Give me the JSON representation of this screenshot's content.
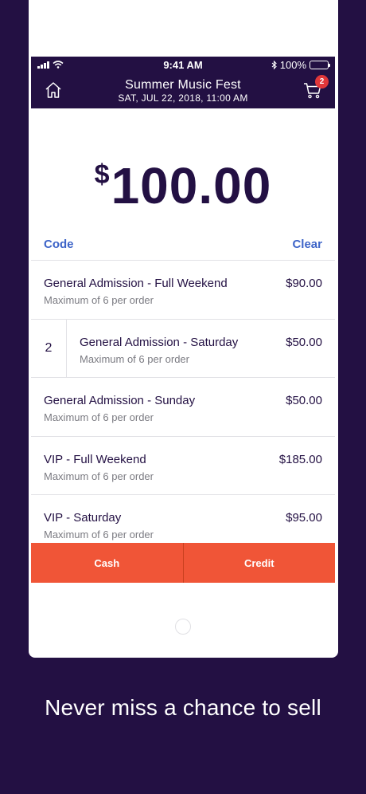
{
  "status_bar": {
    "time": "9:41 AM",
    "battery": "100%",
    "icons": [
      "signal-icon",
      "wifi-icon",
      "bluetooth-icon",
      "battery-icon"
    ]
  },
  "header": {
    "title": "Summer Music Fest",
    "subtitle": "SAT, JUL 22, 2018, 11:00 AM",
    "cart_count": "2",
    "icons": {
      "home": "home-icon",
      "cart": "cart-icon"
    }
  },
  "amount": {
    "currency": "$",
    "value": "100.00"
  },
  "actions": {
    "code": "Code",
    "clear": "Clear"
  },
  "tickets": [
    {
      "name": "General Admission - Full Weekend",
      "limit": "Maximum of 6 per order",
      "price": "$90.00",
      "quantity": ""
    },
    {
      "name": "General Admission - Saturday",
      "limit": "Maximum of 6 per order",
      "price": "$50.00",
      "quantity": "2"
    },
    {
      "name": "General Admission - Sunday",
      "limit": "Maximum of 6 per order",
      "price": "$50.00",
      "quantity": ""
    },
    {
      "name": "VIP - Full Weekend",
      "limit": "Maximum of 6 per order",
      "price": "$185.00",
      "quantity": ""
    },
    {
      "name": "VIP - Saturday",
      "limit": "Maximum of 6 per order",
      "price": "$95.00",
      "quantity": ""
    }
  ],
  "payment": {
    "cash": "Cash",
    "credit": "Credit"
  },
  "tagline": "Never miss a chance to sell",
  "colors": {
    "background": "#231043",
    "accent": "#f05537",
    "link": "#3d64c8",
    "badge": "#e2373a"
  }
}
